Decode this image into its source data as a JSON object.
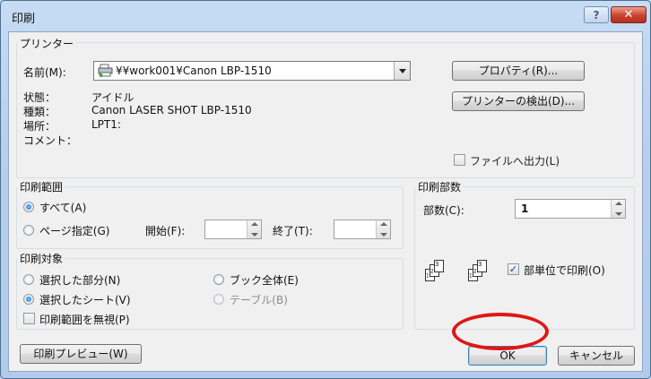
{
  "window": {
    "title": "印刷",
    "help_label": "?",
    "close_label": "✕"
  },
  "printer": {
    "group_label": "プリンター",
    "name_label": "名前(M):",
    "name_value": "¥¥work001¥Canon LBP-1510",
    "status_label": "状態：",
    "status_value": "アイドル",
    "type_label": "種類：",
    "type_value": "Canon LASER SHOT LBP-1510",
    "where_label": "場所：",
    "where_value": "LPT1:",
    "comment_label": "コメント：",
    "properties_button": "プロパティ(R)...",
    "find_button": "プリンターの検出(D)...",
    "print_to_file_label": "ファイルへ出力(L)"
  },
  "range": {
    "group_label": "印刷範囲",
    "all_label": "すべて(A)",
    "pages_label": "ページ指定(G)",
    "from_label": "開始(F):",
    "to_label": "終了(T):"
  },
  "copies": {
    "group_label": "印刷部数",
    "count_label": "部数(C):",
    "count_value": "1",
    "collate_label": "部単位で印刷(O)"
  },
  "target": {
    "group_label": "印刷対象",
    "selection_label": "選択した部分(N)",
    "workbook_label": "ブック全体(E)",
    "sheets_label": "選択したシート(V)",
    "table_label": "テーブル(B)",
    "ignore_area_label": "印刷範囲を無視(P)"
  },
  "footer": {
    "preview_button": "印刷プレビュー(W)",
    "ok_button": "OK",
    "cancel_button": "キャンセル"
  },
  "colors": {
    "annotation": "#e01616",
    "title_bg": "#b9d1ee"
  }
}
